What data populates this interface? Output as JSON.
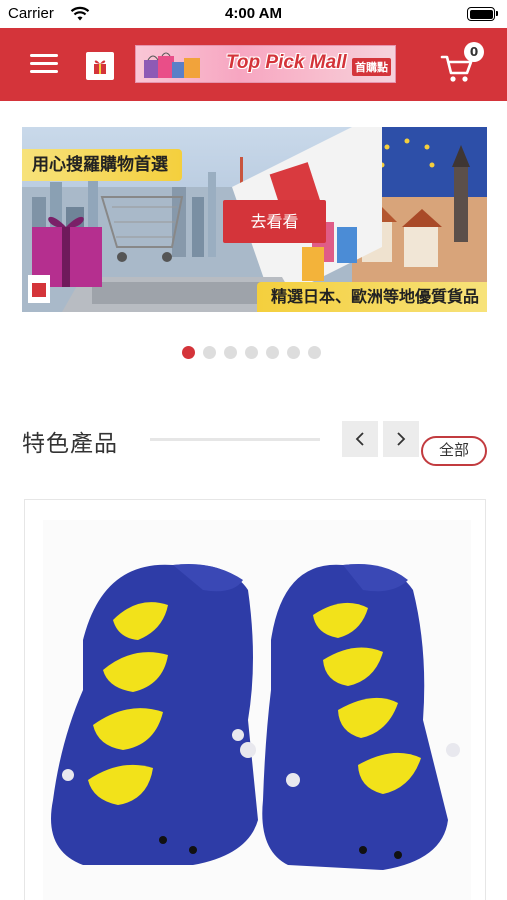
{
  "status_bar": {
    "carrier": "Carrier",
    "time": "4:00 AM"
  },
  "header": {
    "logo_text": "Top Pick Mall",
    "logo_sub": "首購點",
    "cart_count": "0",
    "colors": {
      "brand_red": "#d4343a",
      "white": "#ffffff"
    }
  },
  "hero": {
    "top_label": "用心搜羅購物首選",
    "bottom_label": "精選日本、歐洲等地優質貨品",
    "button_label": "去看看",
    "slide_count": 7,
    "active_slide": 1
  },
  "featured": {
    "title": "特色產品",
    "all_label": "全部",
    "prev_icon": "chevron-left-icon",
    "next_icon": "chevron-right-icon"
  },
  "product": {
    "image_subject": "blue dinosaur baby socks with yellow spikes"
  }
}
